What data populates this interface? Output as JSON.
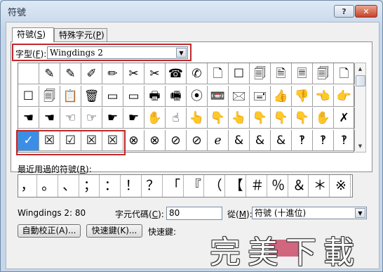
{
  "window": {
    "title": "符號",
    "help_label": "?",
    "close_label": "✕"
  },
  "tabs": [
    {
      "label": "符號(S)",
      "plain": "符號(",
      "key": "S",
      "close": ")",
      "active": true
    },
    {
      "label": "特殊字元(P)",
      "plain": "特殊字元(",
      "key": "P",
      "close": ")",
      "active": false
    }
  ],
  "font_field": {
    "label_pre": "字型(",
    "label_key": "F",
    "label_post": "):",
    "value": "Wingdings 2"
  },
  "symbol_grid": {
    "rows": [
      [
        "",
        "✎",
        "✎",
        "✐",
        "✏",
        "✂",
        "✂",
        "☎",
        "✆",
        "🗋",
        "☐",
        "🗐",
        "🗎",
        "🗏",
        "🗐",
        "🗋"
      ],
      [
        "☐",
        "🗐",
        "📋",
        "🗑",
        "▭",
        "▭",
        "🖶",
        "🖷",
        "⦿",
        "📼",
        "🖂",
        "🖃",
        "👍",
        "👎",
        "👈",
        "👉"
      ],
      [
        "☚",
        "☚",
        "☜",
        "☞",
        "☛",
        "☛",
        "✋",
        "☝",
        "👆",
        "👇",
        "👆",
        "👇",
        "👇",
        "👇",
        "✋",
        "✗"
      ],
      [
        "✓",
        "☒",
        "☑",
        "☒",
        "☒",
        "⊗",
        "⊗",
        "⊘",
        "⊘",
        "ℯ",
        "&",
        "&",
        "&",
        "‽",
        "‽",
        "‽"
      ]
    ],
    "selected": "✓"
  },
  "recent": {
    "label_pre": "最近用過的符號(",
    "label_key": "R",
    "label_post": "):",
    "symbols": [
      "，",
      "。",
      "、",
      "；",
      "：",
      "！",
      "？",
      "「",
      "『",
      "（",
      "【",
      "＃",
      "％",
      "＆",
      "＊",
      "※"
    ]
  },
  "status": {
    "font_code_text": "Wingdings 2: 80",
    "charcode_label_pre": "字元代碼(",
    "charcode_label_key": "C",
    "charcode_label_post": "):",
    "charcode_value": "80",
    "from_label_pre": "從(",
    "from_label_key": "M",
    "from_label_post": "):",
    "from_value": "符號 (十進位)"
  },
  "buttons": {
    "autocorrect": "自動校正(A)...",
    "shortcut": "快速鍵(K)...",
    "shortcut_text_label": "快速鍵:"
  },
  "watermark": "完美下載"
}
